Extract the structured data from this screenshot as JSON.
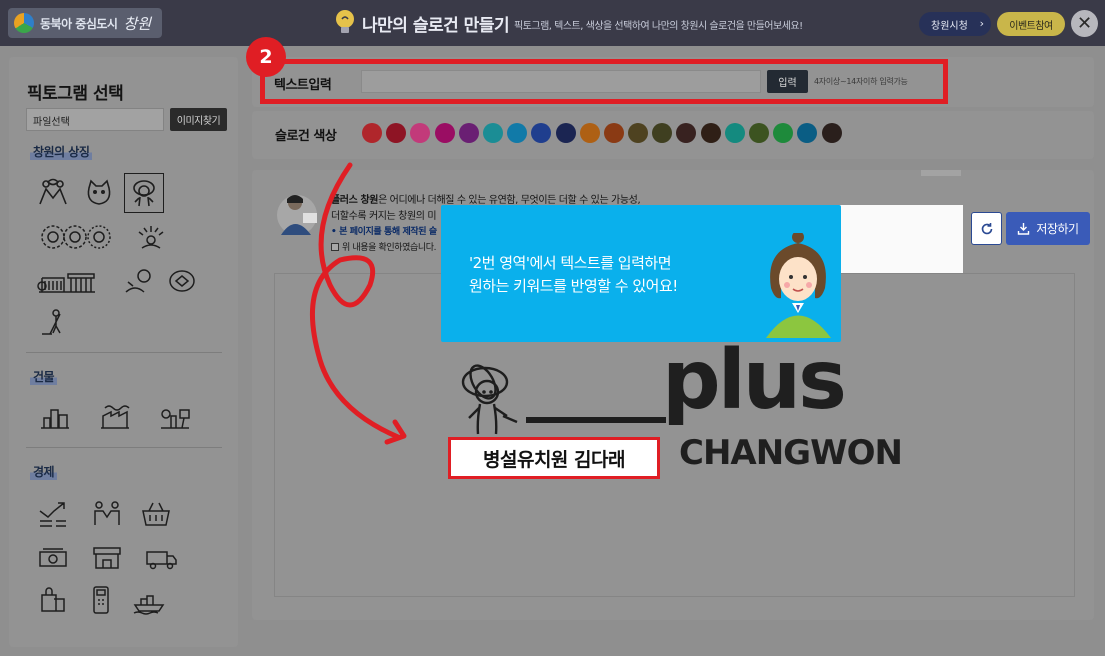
{
  "header": {
    "logo_text": "동북아 중심도시",
    "logo_script": "창원",
    "title": "나만의 슬로건 만들기",
    "subtitle": "픽토그램, 텍스트, 색상을 선택하여 나만의 창원시 슬로건을 만들어보세요!",
    "btn_city": "창원시청",
    "btn_event": "이벤트참여"
  },
  "left": {
    "title": "픽토그램 선택",
    "file_label": "파일선택",
    "image_button": "이미지찾기",
    "sections": [
      "창원의 상징",
      "건물",
      "경제"
    ]
  },
  "text_input": {
    "label": "텍스트입력",
    "value": "",
    "button": "입력",
    "hint": "4자이상~14자이하 입력가능",
    "badge": "2"
  },
  "colors": {
    "label": "슬로건 색상",
    "swatches": [
      "#b0262b",
      "#8e1424",
      "#c23a7a",
      "#9a0d63",
      "#6a1f73",
      "#1b8d95",
      "#117aa8",
      "#1f3e8e",
      "#1b2552",
      "#ae6014",
      "#8a3a14",
      "#4e4220",
      "#3f3f20",
      "#382220",
      "#2f1f16",
      "#148a7f",
      "#3c5320",
      "#1e8a3b",
      "#0a5d84",
      "#2a1f1c"
    ]
  },
  "work": {
    "desc_lead": "플러스 창원",
    "desc_rest": "은 어디에나 더해질 수 있는 유연함, 무엇이든 더할 수 있는 가능성,",
    "desc_line2": "더할수록 커지는 창원의 미",
    "desc_notice": "• 본 페이지를 통해 제작된 슬",
    "desc_confirm": "위 내용을 확인하였습니다.",
    "save_button": "저장하기"
  },
  "tooltip": {
    "line1": "'2번 영역'에서 텍스트를 입력하면",
    "line2": "원하는 키워드를 반영할 수 있어요!"
  },
  "preview": {
    "plus": "plus",
    "changwon": "CHANGWON",
    "slogan": "병설유치원 김다래"
  }
}
